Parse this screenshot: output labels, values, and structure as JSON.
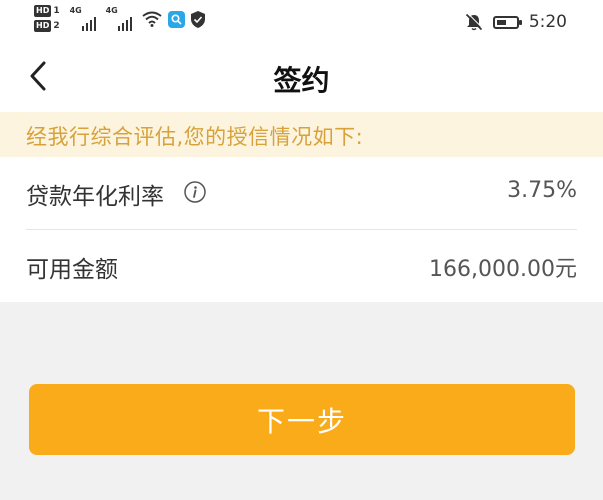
{
  "status_bar": {
    "hd1": "HD",
    "hd1_num": "1",
    "hd2": "HD",
    "hd2_num": "2",
    "net1": "4G",
    "net2": "4G",
    "time": "5:20",
    "battery_level": 0.5,
    "icons": [
      "signal-bars-icon",
      "wifi-icon",
      "search-app-icon",
      "shield-icon",
      "bell-muted-icon",
      "battery-icon"
    ]
  },
  "header": {
    "title": "签约",
    "back_icon": "chevron-left-icon"
  },
  "notice": {
    "text": "经我行综合评估,您的授信情况如下:"
  },
  "info": {
    "rate_label": "贷款年化利率",
    "rate_value": "3.75%",
    "amount_label": "可用金额",
    "amount_value": "166,000.00元"
  },
  "actions": {
    "next_label": "下一步"
  },
  "colors": {
    "accent": "#f9ab19",
    "notice_bg": "#fdf4df",
    "notice_text": "#d8a23a",
    "page_bg": "#f1f1f1"
  }
}
